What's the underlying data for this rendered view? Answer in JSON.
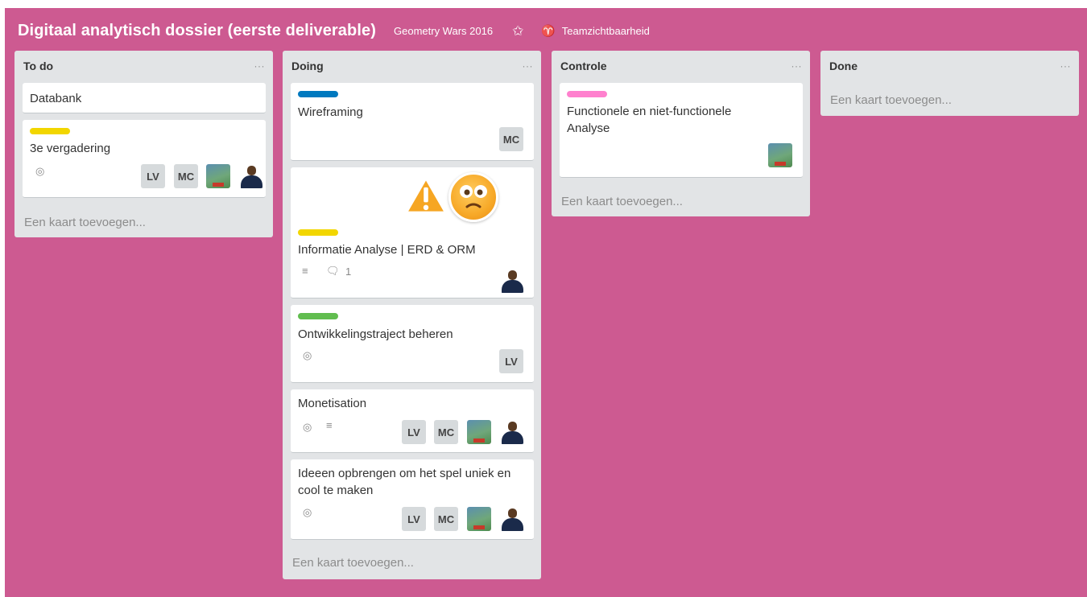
{
  "board": {
    "title": "Digitaal analytisch dossier (eerste deliverable)",
    "team": "Geometry Wars 2016",
    "star_icon": "star-icon",
    "visibility_icon": "team-visibility-icon",
    "visibility": "Teamzichtbaarheid",
    "background": "#cd5a91"
  },
  "lists": [
    {
      "title": "To do",
      "menu": "···",
      "add_card": "Een kaart toevoegen...",
      "cards": [
        {
          "title": "Databank"
        },
        {
          "title": "3e vergadering",
          "label_color": "#f2d600",
          "badges": [
            "watch-icon"
          ],
          "members": [
            "LV",
            "MC",
            "swag-avatar",
            "person-avatar"
          ]
        }
      ]
    },
    {
      "title": "Doing",
      "menu": "···",
      "add_card": "Een kaart toevoegen...",
      "cards": [
        {
          "title": "Wireframing",
          "label_color": "#0079bf",
          "members": [
            "MC"
          ]
        },
        {
          "title": "Informatie Analyse | ERD & ORM",
          "label_color": "#f2d600",
          "stickers": [
            "warning-sticker",
            "worried-face-sticker"
          ],
          "badges": [
            "description-icon",
            "comment-icon"
          ],
          "comment_count": "1",
          "members": [
            "person-avatar"
          ]
        },
        {
          "title": "Ontwikkelingstraject beheren",
          "label_color": "#61bd4f",
          "badges": [
            "watch-icon"
          ],
          "members": [
            "LV"
          ]
        },
        {
          "title": "Monetisation",
          "badges": [
            "watch-icon",
            "description-icon"
          ],
          "members": [
            "LV",
            "MC",
            "swag-avatar",
            "person-avatar"
          ]
        },
        {
          "title": "Ideeen opbrengen om het spel uniek en cool te maken",
          "badges": [
            "watch-icon"
          ],
          "members": [
            "LV",
            "MC",
            "swag-avatar",
            "person-avatar"
          ]
        }
      ]
    },
    {
      "title": "Controle",
      "menu": "···",
      "add_card": "Een kaart toevoegen...",
      "cards": [
        {
          "title": "Functionele en niet-functionele Analyse",
          "label_color": "#ff80ce",
          "members": [
            "swag-avatar"
          ]
        }
      ]
    },
    {
      "title": "Done",
      "menu": "···",
      "add_card": "Een kaart toevoegen...",
      "cards": []
    }
  ]
}
